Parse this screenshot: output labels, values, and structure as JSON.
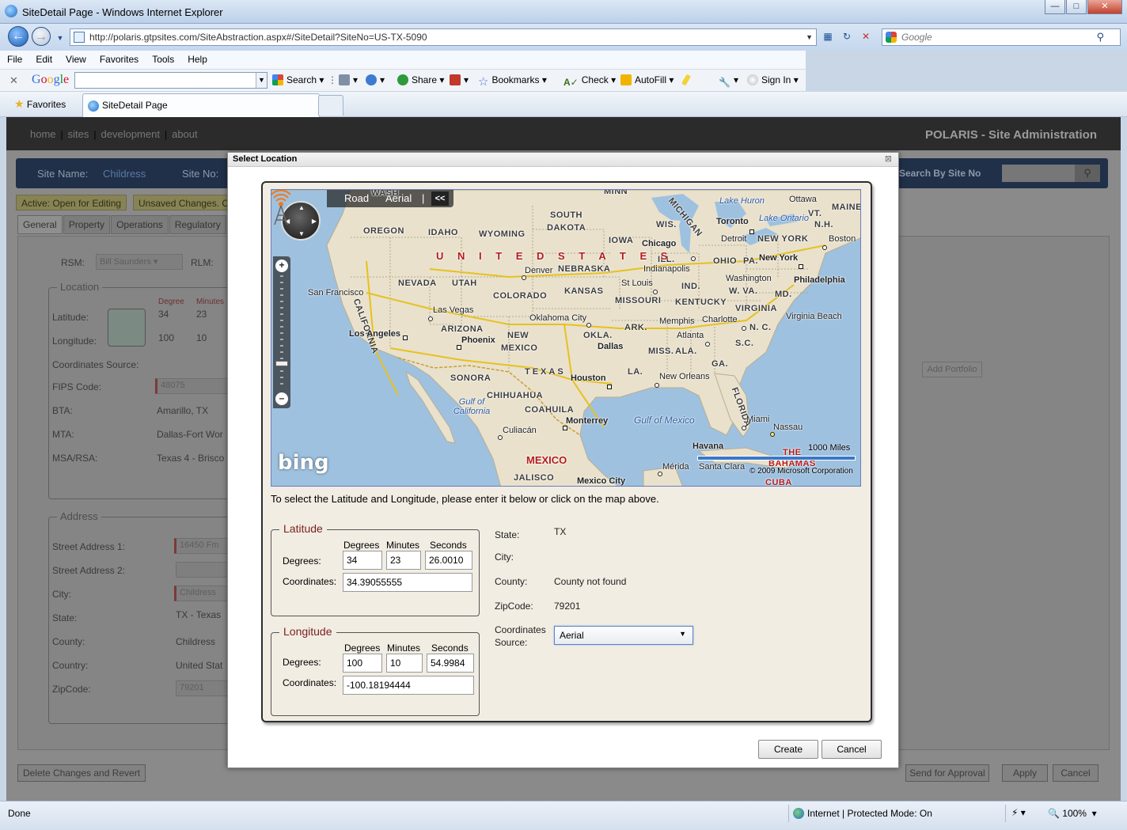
{
  "browser": {
    "window_title": "SiteDetail Page - Windows Internet Explorer",
    "url": "http://polaris.gtpsites.com/SiteAbstraction.aspx#/SiteDetail?SiteNo=US-TX-5090",
    "search_placeholder": "Google",
    "menu": [
      "File",
      "Edit",
      "View",
      "Favorites",
      "Tools",
      "Help"
    ],
    "google_toolbar": {
      "logo": "Google",
      "search_label": "Search",
      "share_label": "Share",
      "bookmarks_label": "Bookmarks",
      "check_label": "Check",
      "autofill_label": "AutoFill",
      "signin_label": "Sign In"
    },
    "favorites_label": "Favorites",
    "tab_title": "SiteDetail Page",
    "status": {
      "left": "Done",
      "zone": "Internet | Protected Mode: On",
      "zoom": "100%"
    }
  },
  "app": {
    "nav": [
      "home",
      "sites",
      "development",
      "about"
    ],
    "brand": "POLARIS - Site Administration",
    "site_name_label": "Site Name:",
    "site_name_value": "Childress",
    "site_no_label": "Site No:",
    "search_by_site_label": "Search By Site No",
    "badges": [
      "Active: Open for Editing",
      "Unsaved Changes. C"
    ],
    "tabs": [
      "General",
      "Property",
      "Operations",
      "Regulatory"
    ],
    "rsm_label": "RSM:",
    "rsm_value": "Bill Saunders",
    "rlm_label": "RLM:",
    "location": {
      "legend": "Location",
      "degree_head": "Degree",
      "minutes_head": "Minutes",
      "latitude_label": "Latitude:",
      "latitude_deg": "34",
      "latitude_min": "23",
      "longitude_label": "Longitude:",
      "longitude_deg": "100",
      "longitude_min": "10",
      "coords_source_label": "Coordinates Source:",
      "fips_label": "FIPS Code:",
      "fips_value": "48075",
      "bta_label": "BTA:",
      "bta_value": "Amarillo, TX",
      "mta_label": "MTA:",
      "mta_value": "Dallas-Fort Wor",
      "msa_label": "MSA/RSA:",
      "msa_value": "Texas 4 - Brisco"
    },
    "add_portfolio": "Add Portfolio",
    "address": {
      "legend": "Address",
      "street1_label": "Street Address 1:",
      "street1_value": "16450 Fm",
      "street2_label": "Street Address 2:",
      "city_label": "City:",
      "city_value": "Childress",
      "state_label": "State:",
      "state_value": "TX - Texas",
      "county_label": "County:",
      "county_value": "Childress",
      "country_label": "Country:",
      "country_value": "United Stat",
      "zip_label": "ZipCode:",
      "zip_value": "79201"
    },
    "bottom_buttons": {
      "revert": "Delete Changes and Revert",
      "send": "Send for Approval",
      "apply": "Apply",
      "cancel": "Cancel"
    }
  },
  "dialog": {
    "title": "Select Location",
    "close": "⊠",
    "map": {
      "road_label": "Road",
      "aerial_label": "Aerial",
      "separator": "|",
      "collapse_label": "<<",
      "bing_logo": "bing",
      "scale_label": "1000 Miles",
      "copyright": "© 2009 Microsoft Corporation",
      "country_label": "U N I T E D   S T A T E S",
      "mexico_label": "MEXICO",
      "states": [
        "WASH",
        "MINN",
        "SOUTH",
        "DAKOTA",
        "WYOMING",
        "IDAHO",
        "OREGON",
        "NEVADA",
        "UTAH",
        "COLORADO",
        "NEBRASKA",
        "KANSAS",
        "IOWA",
        "WIS.",
        "ILL.",
        "IND.",
        "OHIO",
        "PA.",
        "MISSOURI",
        "KENTUCKY",
        "W. VA.",
        "VIRGINIA",
        "N. C.",
        "S.C.",
        "GA.",
        "ALA.",
        "MISS.",
        "ARK.",
        "OKLA.",
        "TEXAS",
        "ARIZONA",
        "NEW",
        "MEXICO",
        "CALIFORNIA",
        "LA.",
        "FLORIDA",
        "MICHIGAN",
        "VT.",
        "MAINE",
        "N.H.",
        "MD.",
        "NEW YORK",
        "SONORA",
        "CHIHUAHUA",
        "COAHUILA",
        "JALISCO",
        "CUBA",
        "THE",
        "BAHAMAS"
      ],
      "cities": [
        "Ottawa",
        "Toronto",
        "Detroit",
        "Boston",
        "New York",
        "Philadelphia",
        "Washington",
        "Chicago",
        "Indianapolis",
        "St Louis",
        "Denver",
        "San Francisco",
        "Las Vegas",
        "Los Angeles",
        "Phoenix",
        "Oklahoma City",
        "Dallas",
        "Memphis",
        "Charlotte",
        "Atlanta",
        "Virginia Beach",
        "Houston",
        "New Orleans",
        "Monterrey",
        "Culiacán",
        "Miami",
        "Nassau",
        "Havana",
        "Santa Clara",
        "Mérida",
        "Mexico City"
      ],
      "waters": [
        "Lake Huron",
        "Lake Ontario",
        "Gulf of California",
        "Gulf of Mexico"
      ]
    },
    "instructions": "To select the Latitude and Longitude, please enter it below or click on the map above.",
    "latitude": {
      "legend": "Latitude",
      "degrees_head": "Degrees",
      "minutes_head": "Minutes",
      "seconds_head": "Seconds",
      "degrees_label": "Degrees:",
      "coords_label": "Coordinates:",
      "degrees": "34",
      "minutes": "23",
      "seconds": "26.0010",
      "coordinates": "34.39055555"
    },
    "longitude": {
      "legend": "Longitude",
      "degrees_head": "Degrees",
      "minutes_head": "Minutes",
      "seconds_head": "Seconds",
      "degrees_label": "Degrees:",
      "coords_label": "Coordinates:",
      "degrees": "100",
      "minutes": "10",
      "seconds": "54.9984",
      "coordinates": "-100.18194444"
    },
    "info": {
      "state_label": "State:",
      "state_value": "TX",
      "city_label": "City:",
      "county_label": "County:",
      "county_value": "County not found",
      "zip_label": "ZipCode:",
      "zip_value": "79201",
      "coords_source_label_1": "Coordinates",
      "coords_source_label_2": "Source:",
      "coords_source_value": "Aerial"
    },
    "create_label": "Create",
    "cancel_label": "Cancel"
  }
}
